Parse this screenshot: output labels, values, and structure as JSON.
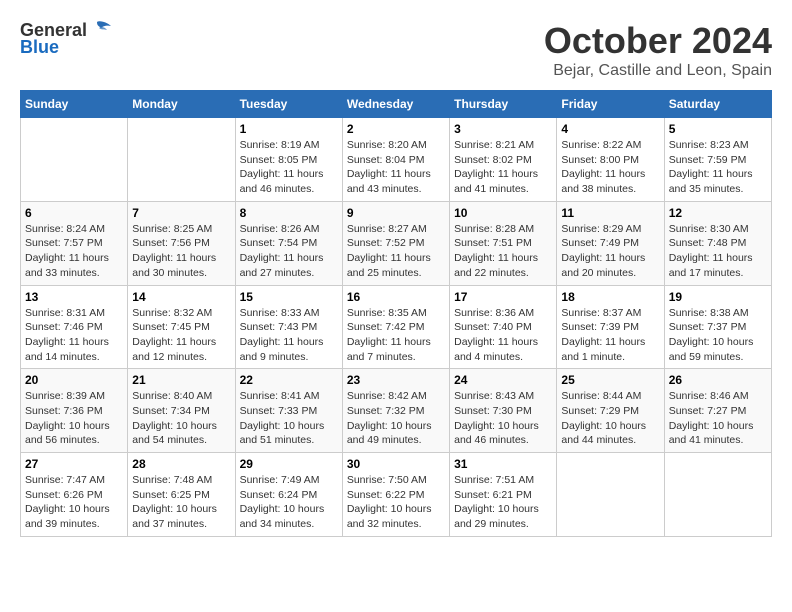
{
  "logo": {
    "general": "General",
    "blue": "Blue"
  },
  "header": {
    "month": "October 2024",
    "location": "Bejar, Castille and Leon, Spain"
  },
  "weekdays": [
    "Sunday",
    "Monday",
    "Tuesday",
    "Wednesday",
    "Thursday",
    "Friday",
    "Saturday"
  ],
  "weeks": [
    [
      {
        "day": "",
        "info": ""
      },
      {
        "day": "",
        "info": ""
      },
      {
        "day": "1",
        "info": "Sunrise: 8:19 AM\nSunset: 8:05 PM\nDaylight: 11 hours and 46 minutes."
      },
      {
        "day": "2",
        "info": "Sunrise: 8:20 AM\nSunset: 8:04 PM\nDaylight: 11 hours and 43 minutes."
      },
      {
        "day": "3",
        "info": "Sunrise: 8:21 AM\nSunset: 8:02 PM\nDaylight: 11 hours and 41 minutes."
      },
      {
        "day": "4",
        "info": "Sunrise: 8:22 AM\nSunset: 8:00 PM\nDaylight: 11 hours and 38 minutes."
      },
      {
        "day": "5",
        "info": "Sunrise: 8:23 AM\nSunset: 7:59 PM\nDaylight: 11 hours and 35 minutes."
      }
    ],
    [
      {
        "day": "6",
        "info": "Sunrise: 8:24 AM\nSunset: 7:57 PM\nDaylight: 11 hours and 33 minutes."
      },
      {
        "day": "7",
        "info": "Sunrise: 8:25 AM\nSunset: 7:56 PM\nDaylight: 11 hours and 30 minutes."
      },
      {
        "day": "8",
        "info": "Sunrise: 8:26 AM\nSunset: 7:54 PM\nDaylight: 11 hours and 27 minutes."
      },
      {
        "day": "9",
        "info": "Sunrise: 8:27 AM\nSunset: 7:52 PM\nDaylight: 11 hours and 25 minutes."
      },
      {
        "day": "10",
        "info": "Sunrise: 8:28 AM\nSunset: 7:51 PM\nDaylight: 11 hours and 22 minutes."
      },
      {
        "day": "11",
        "info": "Sunrise: 8:29 AM\nSunset: 7:49 PM\nDaylight: 11 hours and 20 minutes."
      },
      {
        "day": "12",
        "info": "Sunrise: 8:30 AM\nSunset: 7:48 PM\nDaylight: 11 hours and 17 minutes."
      }
    ],
    [
      {
        "day": "13",
        "info": "Sunrise: 8:31 AM\nSunset: 7:46 PM\nDaylight: 11 hours and 14 minutes."
      },
      {
        "day": "14",
        "info": "Sunrise: 8:32 AM\nSunset: 7:45 PM\nDaylight: 11 hours and 12 minutes."
      },
      {
        "day": "15",
        "info": "Sunrise: 8:33 AM\nSunset: 7:43 PM\nDaylight: 11 hours and 9 minutes."
      },
      {
        "day": "16",
        "info": "Sunrise: 8:35 AM\nSunset: 7:42 PM\nDaylight: 11 hours and 7 minutes."
      },
      {
        "day": "17",
        "info": "Sunrise: 8:36 AM\nSunset: 7:40 PM\nDaylight: 11 hours and 4 minutes."
      },
      {
        "day": "18",
        "info": "Sunrise: 8:37 AM\nSunset: 7:39 PM\nDaylight: 11 hours and 1 minute."
      },
      {
        "day": "19",
        "info": "Sunrise: 8:38 AM\nSunset: 7:37 PM\nDaylight: 10 hours and 59 minutes."
      }
    ],
    [
      {
        "day": "20",
        "info": "Sunrise: 8:39 AM\nSunset: 7:36 PM\nDaylight: 10 hours and 56 minutes."
      },
      {
        "day": "21",
        "info": "Sunrise: 8:40 AM\nSunset: 7:34 PM\nDaylight: 10 hours and 54 minutes."
      },
      {
        "day": "22",
        "info": "Sunrise: 8:41 AM\nSunset: 7:33 PM\nDaylight: 10 hours and 51 minutes."
      },
      {
        "day": "23",
        "info": "Sunrise: 8:42 AM\nSunset: 7:32 PM\nDaylight: 10 hours and 49 minutes."
      },
      {
        "day": "24",
        "info": "Sunrise: 8:43 AM\nSunset: 7:30 PM\nDaylight: 10 hours and 46 minutes."
      },
      {
        "day": "25",
        "info": "Sunrise: 8:44 AM\nSunset: 7:29 PM\nDaylight: 10 hours and 44 minutes."
      },
      {
        "day": "26",
        "info": "Sunrise: 8:46 AM\nSunset: 7:27 PM\nDaylight: 10 hours and 41 minutes."
      }
    ],
    [
      {
        "day": "27",
        "info": "Sunrise: 7:47 AM\nSunset: 6:26 PM\nDaylight: 10 hours and 39 minutes."
      },
      {
        "day": "28",
        "info": "Sunrise: 7:48 AM\nSunset: 6:25 PM\nDaylight: 10 hours and 37 minutes."
      },
      {
        "day": "29",
        "info": "Sunrise: 7:49 AM\nSunset: 6:24 PM\nDaylight: 10 hours and 34 minutes."
      },
      {
        "day": "30",
        "info": "Sunrise: 7:50 AM\nSunset: 6:22 PM\nDaylight: 10 hours and 32 minutes."
      },
      {
        "day": "31",
        "info": "Sunrise: 7:51 AM\nSunset: 6:21 PM\nDaylight: 10 hours and 29 minutes."
      },
      {
        "day": "",
        "info": ""
      },
      {
        "day": "",
        "info": ""
      }
    ]
  ]
}
